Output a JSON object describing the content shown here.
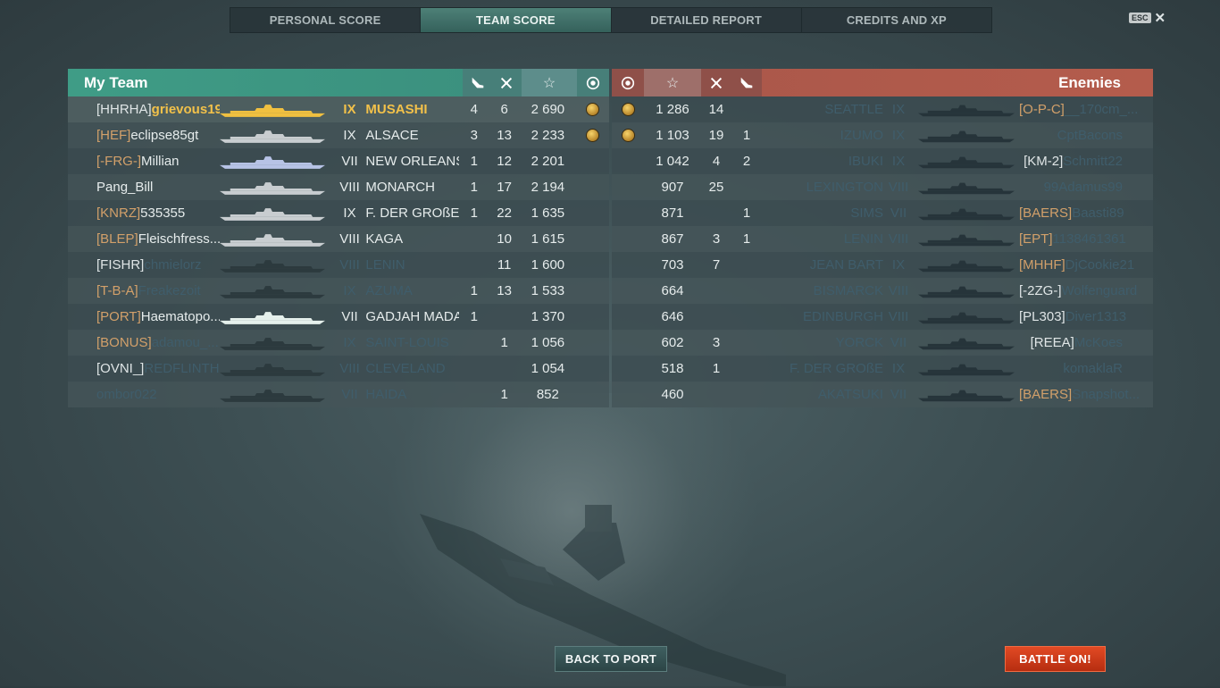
{
  "tabs": [
    {
      "label": "PERSONAL SCORE",
      "active": false
    },
    {
      "label": "TEAM SCORE",
      "active": true
    },
    {
      "label": "DETAILED REPORT",
      "active": false
    },
    {
      "label": "CREDITS AND XP",
      "active": false
    }
  ],
  "close": {
    "key_label": "ESC",
    "icon": "close-icon"
  },
  "my_team": {
    "title": "My Team",
    "color": "#3e9e86",
    "rows": [
      {
        "clan": "[HHRHA]",
        "name": "grievous19...",
        "tier": "IX",
        "ship": "MUSASHI",
        "planes": "4",
        "frags": "6",
        "xp": "2 690",
        "medal": true,
        "highlight": true
      },
      {
        "clan": "[HEF]",
        "name": "eclipse85gt",
        "tier": "IX",
        "ship": "ALSACE",
        "planes": "3",
        "frags": "13",
        "xp": "2 233",
        "medal": true
      },
      {
        "clan": "[-FRG-]",
        "name": "Millian",
        "tier": "VII",
        "ship": "NEW ORLEANS",
        "planes": "1",
        "frags": "12",
        "xp": "2 201",
        "medal": false
      },
      {
        "clan": "",
        "name": "Pang_Bill",
        "tier": "VIII",
        "ship": "MONARCH",
        "planes": "1",
        "frags": "17",
        "xp": "2 194",
        "medal": false
      },
      {
        "clan": "[KNRZ]",
        "name": "535355",
        "tier": "IX",
        "ship": "F. DER GROßE",
        "planes": "1",
        "frags": "22",
        "xp": "1 635",
        "medal": false
      },
      {
        "clan": "[BLEP]",
        "name": "Fleischfress...",
        "tier": "VIII",
        "ship": "KAGA",
        "planes": "",
        "frags": "10",
        "xp": "1 615",
        "medal": false
      },
      {
        "clan": "[FISHR]",
        "name": "chmielorz",
        "tier": "VIII",
        "ship": "LENIN",
        "planes": "",
        "frags": "11",
        "xp": "1 600",
        "medal": false,
        "dead": true
      },
      {
        "clan": "[T-B-A]",
        "name": "Freakezoit",
        "tier": "IX",
        "ship": "AZUMA",
        "planes": "1",
        "frags": "13",
        "xp": "1 533",
        "medal": false,
        "dead": true
      },
      {
        "clan": "[PORT]",
        "name": "Haematopo...",
        "tier": "VII",
        "ship": "GADJAH MADA",
        "planes": "1",
        "frags": "",
        "xp": "1 370",
        "medal": false
      },
      {
        "clan": "[BONUS]",
        "name": "adamou_...",
        "tier": "IX",
        "ship": "SAINT-LOUIS",
        "planes": "",
        "frags": "1",
        "xp": "1 056",
        "medal": false,
        "dead": true
      },
      {
        "clan": "[OVNI_]",
        "name": "REDFLINTH",
        "tier": "VIII",
        "ship": "CLEVELAND",
        "planes": "",
        "frags": "",
        "xp": "1 054",
        "medal": false,
        "dead": true
      },
      {
        "clan": "",
        "name": "ombor022",
        "tier": "VII",
        "ship": "HAIDA",
        "planes": "",
        "frags": "1",
        "xp": "852",
        "medal": false,
        "dead": true
      }
    ]
  },
  "enemies": {
    "title": "Enemies",
    "color": "#b5594a",
    "rows": [
      {
        "medal": true,
        "xp": "1 286",
        "frags": "14",
        "planes": "",
        "ship": "SEATTLE",
        "tier": "IX",
        "clan": "[O-P-C]",
        "name": "__170cm_..."
      },
      {
        "medal": true,
        "xp": "1 103",
        "frags": "19",
        "planes": "1",
        "ship": "IZUMO",
        "tier": "IX",
        "clan": "",
        "name": "CptBacons"
      },
      {
        "medal": false,
        "xp": "1 042",
        "frags": "4",
        "planes": "2",
        "ship": "IBUKI",
        "tier": "IX",
        "clan": "[KM-2]",
        "name": "Schmitt22"
      },
      {
        "medal": false,
        "xp": "907",
        "frags": "25",
        "planes": "",
        "ship": "LEXINGTON",
        "tier": "VIII",
        "clan": "",
        "name": "99Adamus99"
      },
      {
        "medal": false,
        "xp": "871",
        "frags": "",
        "planes": "1",
        "ship": "SIMS",
        "tier": "VII",
        "clan": "[BAERS]",
        "name": "Baasti89"
      },
      {
        "medal": false,
        "xp": "867",
        "frags": "3",
        "planes": "1",
        "ship": "LENIN",
        "tier": "VIII",
        "clan": "[EPT]",
        "name": "1138461361"
      },
      {
        "medal": false,
        "xp": "703",
        "frags": "7",
        "planes": "",
        "ship": "JEAN BART",
        "tier": "IX",
        "clan": "[MHHF]",
        "name": "DjCookie21"
      },
      {
        "medal": false,
        "xp": "664",
        "frags": "",
        "planes": "",
        "ship": "BISMARCK",
        "tier": "VIII",
        "clan": "[-2ZG-]",
        "name": "Wolfenguard"
      },
      {
        "medal": false,
        "xp": "646",
        "frags": "",
        "planes": "",
        "ship": "EDINBURGH",
        "tier": "VIII",
        "clan": "[PL303]",
        "name": "Diver1313"
      },
      {
        "medal": false,
        "xp": "602",
        "frags": "3",
        "planes": "",
        "ship": "YORCK",
        "tier": "VII",
        "clan": "[REEA]",
        "name": "McKoes"
      },
      {
        "medal": false,
        "xp": "518",
        "frags": "1",
        "planes": "",
        "ship": "F. DER GROßE",
        "tier": "IX",
        "clan": "",
        "name": "komaklaR"
      },
      {
        "medal": false,
        "xp": "460",
        "frags": "",
        "planes": "",
        "ship": "AKATSUKI",
        "tier": "VII",
        "clan": "[BAERS]",
        "name": "Snapshot..."
      }
    ]
  },
  "column_icons": [
    "plane-kills-icon",
    "frags-icon",
    "star-icon",
    "medal-icon"
  ],
  "buttons": {
    "back": "BACK TO PORT",
    "battle": "BATTLE ON!"
  }
}
